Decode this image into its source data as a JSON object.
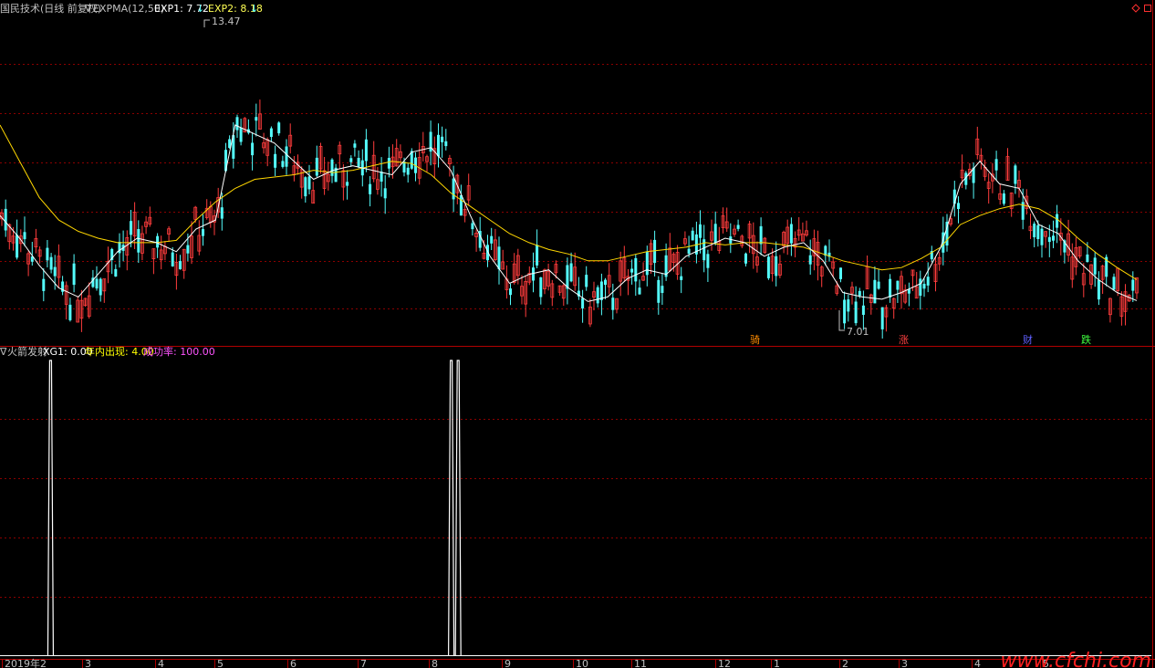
{
  "main_panel": {
    "title": "国民技术(日线 前复权)",
    "indicator_marker": "∇",
    "indicator_name": "EXPMA(12,50)",
    "exp1_label": "EXP1: 7.72",
    "exp1_arrow": "↓",
    "exp2_label": "EXP2: 8.18",
    "exp2_arrow": "↓",
    "high_label": "13.47",
    "low_label": "7.01",
    "event_markers": [
      "骑",
      "涨",
      "财",
      "跌"
    ],
    "corner_icons": [
      "diamond-icon",
      "square-icon"
    ]
  },
  "sub_panel": {
    "marker": "∇",
    "title": "火箭发射",
    "xg1_label": "XG1: 0.00",
    "yearly_label": "年内出现: 4.00",
    "success_label": "成功率: 100.00"
  },
  "x_axis": {
    "ticks": [
      "2019年2",
      "3",
      "4",
      "5",
      "6",
      "7",
      "8",
      "9",
      "10",
      "11",
      "12",
      "1",
      "2",
      "3",
      "4",
      "5"
    ]
  },
  "watermark": "www.cfchi.com",
  "colors": {
    "up": "#ff3c3c",
    "down": "#54fcfc",
    "exp1": "#ffffff",
    "exp2": "#ffd700",
    "grid": "#8b0000",
    "frame": "#b00000",
    "exp2_text": "#ffff54",
    "yearly_text": "#ffff00",
    "success_text": "#ff54ff",
    "marker_ride": "#ff8c00",
    "marker_rise": "#ff4040",
    "marker_wealth": "#6060ff",
    "marker_fall": "#40ff40",
    "watermark": "#ff2020"
  },
  "chart_data": [
    {
      "type": "candlestick",
      "title": "国民技术(日线 前复权)",
      "ylim": [
        6.8,
        14.0
      ],
      "annotations": {
        "high": 13.47,
        "low": 7.01
      },
      "series": [
        {
          "name": "EXP1",
          "last": 7.72,
          "values": [
            9.6,
            9.1,
            8.5,
            8.0,
            7.8,
            8.3,
            8.8,
            9.1,
            9.0,
            8.8,
            9.3,
            9.5,
            11.6,
            11.4,
            11.2,
            10.8,
            10.4,
            10.6,
            10.7,
            10.6,
            10.5,
            11.0,
            11.1,
            10.6,
            9.6,
            8.7,
            8.1,
            8.3,
            8.4,
            8.0,
            7.7,
            7.8,
            8.2,
            8.4,
            8.3,
            8.7,
            8.9,
            9.1,
            9.0,
            8.7,
            8.9,
            9.0,
            8.6,
            7.9,
            7.8,
            7.75,
            7.9,
            8.1,
            8.9,
            10.3,
            10.8,
            10.3,
            10.2,
            9.4,
            9.2,
            8.6,
            8.2,
            7.9,
            7.72
          ]
        },
        {
          "name": "EXP2",
          "last": 8.18,
          "values": [
            11.6,
            10.8,
            10.0,
            9.5,
            9.25,
            9.1,
            9.0,
            9.0,
            9.0,
            9.05,
            9.5,
            9.9,
            10.2,
            10.4,
            10.45,
            10.5,
            10.6,
            10.55,
            10.6,
            10.7,
            10.8,
            10.75,
            10.5,
            10.1,
            9.8,
            9.5,
            9.2,
            9.0,
            8.85,
            8.75,
            8.6,
            8.6,
            8.7,
            8.8,
            8.85,
            8.9,
            9.0,
            8.95,
            9.0,
            9.0,
            8.95,
            8.9,
            8.75,
            8.6,
            8.5,
            8.4,
            8.45,
            8.65,
            8.9,
            9.4,
            9.6,
            9.75,
            9.85,
            9.75,
            9.5,
            9.1,
            8.75,
            8.45,
            8.18
          ]
        }
      ]
    },
    {
      "type": "line",
      "title": "火箭发射",
      "ylim": [
        0,
        1
      ],
      "series": [
        {
          "name": "XG1",
          "last": 0.0,
          "spike_positions": [
            0.036,
            0.384,
            0.39
          ]
        }
      ]
    }
  ]
}
